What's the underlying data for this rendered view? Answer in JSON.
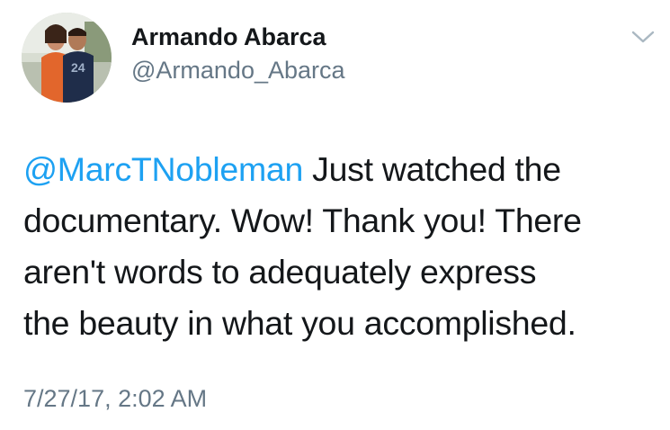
{
  "author": {
    "display_name": "Armando Abarca",
    "handle": "@Armando_Abarca"
  },
  "tweet": {
    "mention": "@MarcTNobleman",
    "line1_rest": " Just watched the",
    "line2": "documentary. Wow! Thank you! There",
    "line3": "aren't words to adequately express",
    "line4": "the beauty in what you accomplished.",
    "timestamp": "7/27/17, 2:02 AM"
  },
  "icons": {
    "menu": "chevron-down-icon"
  },
  "colors": {
    "link": "#1da1f2",
    "text": "#14171a",
    "secondary": "#657786"
  }
}
